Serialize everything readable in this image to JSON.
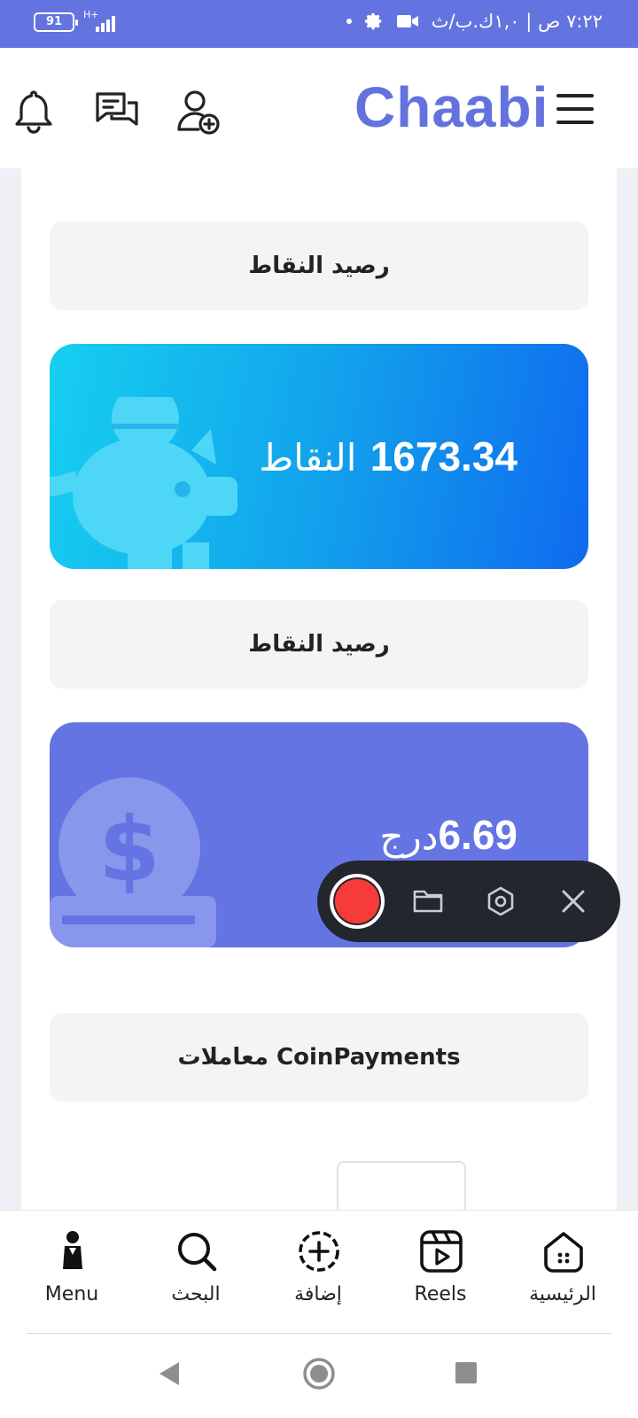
{
  "status_bar": {
    "battery": "91",
    "network": "H+",
    "time_text": "٧:٢٢ ص | ١,٠ك.ب/ث"
  },
  "header": {
    "brand": "Chaabi",
    "icons": [
      "bell-icon",
      "chat-icon",
      "add-user-icon",
      "menu-icon"
    ]
  },
  "sections": {
    "points_label_1": "رصيد النقاط",
    "points_value": "1673.34",
    "points_unit": "النقاط",
    "points_label_2": "رصيد النقاط",
    "money_value": "6.69",
    "money_unit": "درج",
    "transactions_label": "معاملات CoinPayments"
  },
  "colors": {
    "brand": "#6372dd",
    "status_bar": "#6373e0",
    "blue_card_start": "#16cff0",
    "blue_card_end": "#0f6aee",
    "purple_card": "#6474e3",
    "record_red": "#f63b3b"
  },
  "recorder": {
    "icons": [
      "record-icon",
      "folder-icon",
      "settings-icon",
      "close-icon"
    ]
  },
  "bottom_nav": {
    "items": [
      {
        "label": "Menu",
        "icon": "user-icon"
      },
      {
        "label": "البحث",
        "icon": "search-icon"
      },
      {
        "label": "إضافة",
        "icon": "add-circle-icon"
      },
      {
        "label": "Reels",
        "icon": "reels-icon"
      },
      {
        "label": "الرئيسية",
        "icon": "home-icon"
      }
    ]
  },
  "system_nav": {
    "icons": [
      "back-icon",
      "home-circle-icon",
      "recents-icon"
    ]
  }
}
